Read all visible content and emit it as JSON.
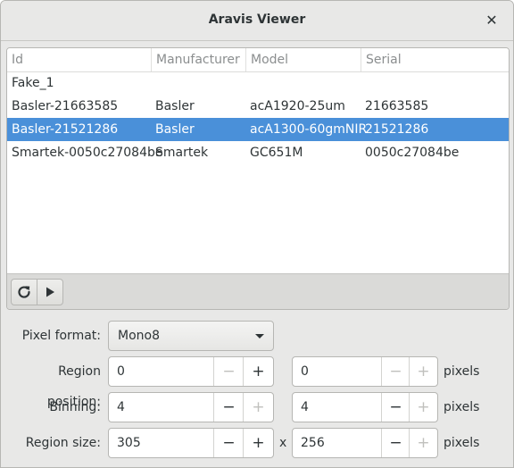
{
  "window": {
    "title": "Aravis Viewer"
  },
  "table": {
    "headers": [
      "Id",
      "Manufacturer",
      "Model",
      "Serial"
    ],
    "rows": [
      [
        "Fake_1",
        "",
        "",
        ""
      ],
      [
        "Basler-21663585",
        "Basler",
        "acA1920-25um",
        "21663585"
      ],
      [
        "Basler-21521286",
        "Basler",
        "acA1300-60gmNIR",
        "21521286"
      ],
      [
        "Smartek-0050c27084be",
        "Smartek",
        "GC651M",
        "0050c27084be"
      ]
    ],
    "selected_row": 2
  },
  "toolbar": {
    "refresh_icon": "refresh-icon",
    "play_icon": "play-icon"
  },
  "form": {
    "pixel_format_label": "Pixel format:",
    "pixel_format_value": "Mono8",
    "region_position_label": "Region position:",
    "region_position_x": "0",
    "region_position_y": "0",
    "binning_label": "Binning:",
    "binning_x": "4",
    "binning_y": "4",
    "region_size_label": "Region size:",
    "region_size_x": "305",
    "region_size_y": "256",
    "unit": "pixels",
    "x_separator": "x",
    "minus": "−",
    "plus": "+"
  },
  "colors": {
    "selection": "#4a90d9"
  }
}
